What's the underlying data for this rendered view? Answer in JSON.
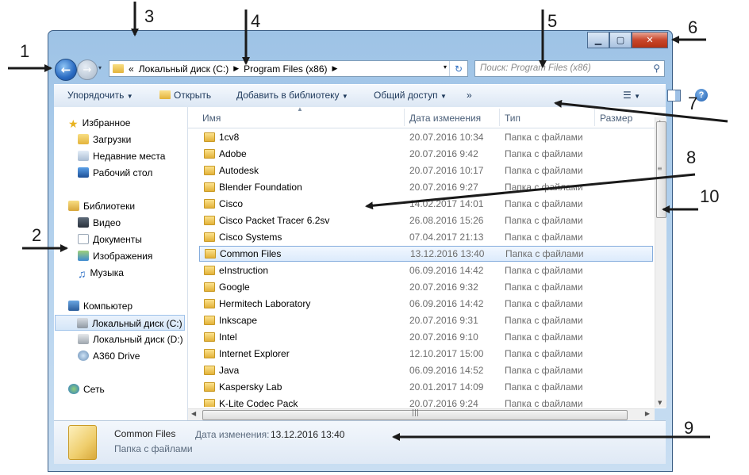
{
  "window": {
    "buttons": {
      "minimize": "▁",
      "maximize": "▢",
      "close": "✕"
    }
  },
  "nav_buttons": {
    "back": "←",
    "forward": "→",
    "history": "▾"
  },
  "address": {
    "prefix": "«",
    "crumbs": [
      "Локальный диск (C:)",
      "Program Files (x86)"
    ],
    "separator": "▶",
    "dropdown": "▾",
    "refresh": "↻"
  },
  "search": {
    "placeholder": "Поиск: Program Files (x86)",
    "icon": "search-icon"
  },
  "toolbar": {
    "organize": "Упорядочить",
    "open": "Открыть",
    "add_to_library": "Добавить в библиотеку",
    "share": "Общий доступ",
    "more": "»",
    "dropdown": "▼"
  },
  "sidebar": {
    "favorites": {
      "label": "Избранное",
      "items": [
        "Загрузки",
        "Недавние места",
        "Рабочий стол"
      ]
    },
    "libraries": {
      "label": "Библиотеки",
      "items": [
        "Видео",
        "Документы",
        "Изображения",
        "Музыка"
      ]
    },
    "computer": {
      "label": "Компьютер",
      "items": [
        "Локальный диск (C:)",
        "Локальный диск (D:)",
        "A360 Drive"
      ]
    },
    "network": {
      "label": "Сеть"
    }
  },
  "columns": {
    "name": "Имя",
    "date": "Дата изменения",
    "type": "Тип",
    "size": "Размер"
  },
  "files": [
    {
      "name": "1cv8",
      "date": "20.07.2016 10:34",
      "type": "Папка с файлами"
    },
    {
      "name": "Adobe",
      "date": "20.07.2016 9:42",
      "type": "Папка с файлами"
    },
    {
      "name": "Autodesk",
      "date": "20.07.2016 10:17",
      "type": "Папка с файлами"
    },
    {
      "name": "Blender Foundation",
      "date": "20.07.2016 9:27",
      "type": "Папка с файлами"
    },
    {
      "name": "Cisco",
      "date": "14.02.2017 14:01",
      "type": "Папка с файлами"
    },
    {
      "name": "Cisco Packet Tracer 6.2sv",
      "date": "26.08.2016 15:26",
      "type": "Папка с файлами"
    },
    {
      "name": "Cisco Systems",
      "date": "07.04.2017 21:13",
      "type": "Папка с файлами"
    },
    {
      "name": "Common Files",
      "date": "13.12.2016 13:40",
      "type": "Папка с файлами"
    },
    {
      "name": "eInstruction",
      "date": "06.09.2016 14:42",
      "type": "Папка с файлами"
    },
    {
      "name": "Google",
      "date": "20.07.2016 9:32",
      "type": "Папка с файлами"
    },
    {
      "name": "Hermitech Laboratory",
      "date": "06.09.2016 14:42",
      "type": "Папка с файлами"
    },
    {
      "name": "Inkscape",
      "date": "20.07.2016 9:31",
      "type": "Папка с файлами"
    },
    {
      "name": "Intel",
      "date": "20.07.2016 9:10",
      "type": "Папка с файлами"
    },
    {
      "name": "Internet Explorer",
      "date": "12.10.2017 15:00",
      "type": "Папка с файлами"
    },
    {
      "name": "Java",
      "date": "06.09.2016 14:52",
      "type": "Папка с файлами"
    },
    {
      "name": "Kaspersky Lab",
      "date": "20.01.2017 14:09",
      "type": "Папка с файлами"
    },
    {
      "name": "K-Lite Codec Pack",
      "date": "20.07.2016 9:24",
      "type": "Папка с файлами"
    }
  ],
  "selected_index": 7,
  "details": {
    "name": "Common Files",
    "type": "Папка с файлами",
    "date_label": "Дата изменения:",
    "date_value": "13.12.2016 13:40"
  },
  "callouts": [
    "1",
    "2",
    "3",
    "4",
    "5",
    "6",
    "7",
    "8",
    "9",
    "10"
  ],
  "colors": {
    "accent": "#3372c2",
    "selection": "#dcebfc",
    "close": "#c8462b"
  }
}
